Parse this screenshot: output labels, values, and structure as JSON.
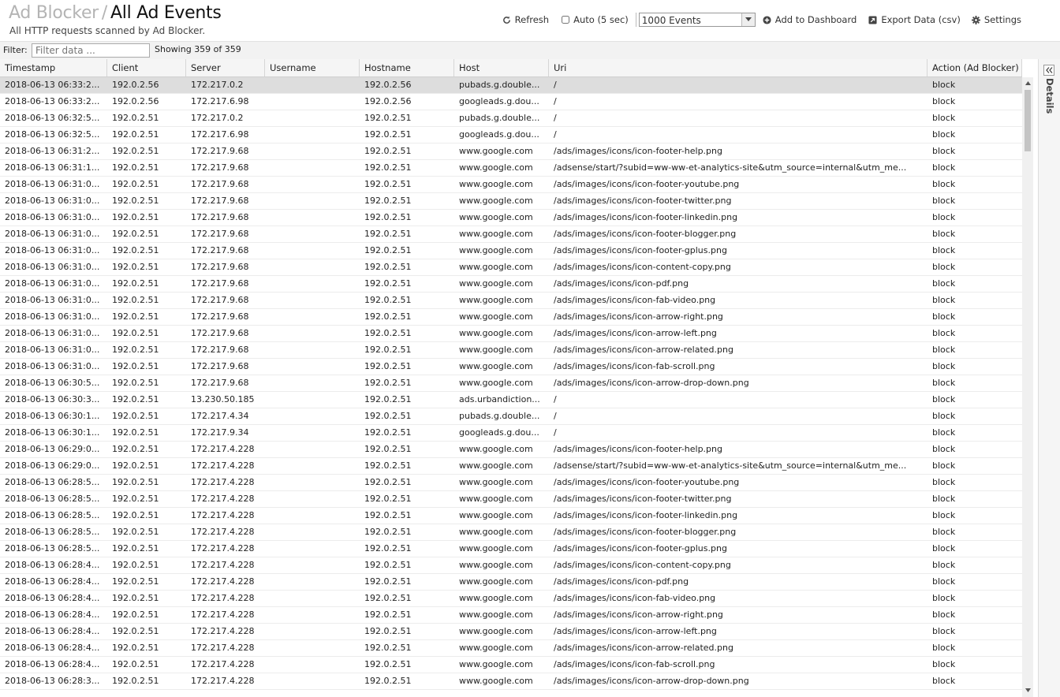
{
  "header": {
    "crumb": "Ad Blocker",
    "separator": "/",
    "title": "All Ad Events",
    "subtitle": "All HTTP requests scanned by Ad Blocker."
  },
  "toolbar": {
    "refresh_label": "Refresh",
    "auto_label": "Auto (5 sec)",
    "events_select": "1000 Events",
    "add_dashboard_label": "Add to Dashboard",
    "export_label": "Export Data (csv)",
    "settings_label": "Settings"
  },
  "filter": {
    "label": "Filter:",
    "placeholder": "Filter data ...",
    "showing": "Showing 359 of 359"
  },
  "columns": [
    "Timestamp",
    "Client",
    "Server",
    "Username",
    "Hostname",
    "Host",
    "Uri",
    "Action (Ad Blocker)"
  ],
  "rows": [
    [
      "2018-06-13 06:33:2...",
      "192.0.2.56",
      "172.217.0.2",
      "",
      "192.0.2.56",
      "pubads.g.double...",
      "/",
      "block"
    ],
    [
      "2018-06-13 06:33:2...",
      "192.0.2.56",
      "172.217.6.98",
      "",
      "192.0.2.56",
      "googleads.g.dou...",
      "/",
      "block"
    ],
    [
      "2018-06-13 06:32:5...",
      "192.0.2.51",
      "172.217.0.2",
      "",
      "192.0.2.51",
      "pubads.g.double...",
      "/",
      "block"
    ],
    [
      "2018-06-13 06:32:5...",
      "192.0.2.51",
      "172.217.6.98",
      "",
      "192.0.2.51",
      "googleads.g.dou...",
      "/",
      "block"
    ],
    [
      "2018-06-13 06:31:2...",
      "192.0.2.51",
      "172.217.9.68",
      "",
      "192.0.2.51",
      "www.google.com",
      "/ads/images/icons/icon-footer-help.png",
      "block"
    ],
    [
      "2018-06-13 06:31:1...",
      "192.0.2.51",
      "172.217.9.68",
      "",
      "192.0.2.51",
      "www.google.com",
      "/adsense/start/?subid=ww-ww-et-analytics-site&utm_source=internal&utm_me...",
      "block"
    ],
    [
      "2018-06-13 06:31:0...",
      "192.0.2.51",
      "172.217.9.68",
      "",
      "192.0.2.51",
      "www.google.com",
      "/ads/images/icons/icon-footer-youtube.png",
      "block"
    ],
    [
      "2018-06-13 06:31:0...",
      "192.0.2.51",
      "172.217.9.68",
      "",
      "192.0.2.51",
      "www.google.com",
      "/ads/images/icons/icon-footer-twitter.png",
      "block"
    ],
    [
      "2018-06-13 06:31:0...",
      "192.0.2.51",
      "172.217.9.68",
      "",
      "192.0.2.51",
      "www.google.com",
      "/ads/images/icons/icon-footer-linkedin.png",
      "block"
    ],
    [
      "2018-06-13 06:31:0...",
      "192.0.2.51",
      "172.217.9.68",
      "",
      "192.0.2.51",
      "www.google.com",
      "/ads/images/icons/icon-footer-blogger.png",
      "block"
    ],
    [
      "2018-06-13 06:31:0...",
      "192.0.2.51",
      "172.217.9.68",
      "",
      "192.0.2.51",
      "www.google.com",
      "/ads/images/icons/icon-footer-gplus.png",
      "block"
    ],
    [
      "2018-06-13 06:31:0...",
      "192.0.2.51",
      "172.217.9.68",
      "",
      "192.0.2.51",
      "www.google.com",
      "/ads/images/icons/icon-content-copy.png",
      "block"
    ],
    [
      "2018-06-13 06:31:0...",
      "192.0.2.51",
      "172.217.9.68",
      "",
      "192.0.2.51",
      "www.google.com",
      "/ads/images/icons/icon-pdf.png",
      "block"
    ],
    [
      "2018-06-13 06:31:0...",
      "192.0.2.51",
      "172.217.9.68",
      "",
      "192.0.2.51",
      "www.google.com",
      "/ads/images/icons/icon-fab-video.png",
      "block"
    ],
    [
      "2018-06-13 06:31:0...",
      "192.0.2.51",
      "172.217.9.68",
      "",
      "192.0.2.51",
      "www.google.com",
      "/ads/images/icons/icon-arrow-right.png",
      "block"
    ],
    [
      "2018-06-13 06:31:0...",
      "192.0.2.51",
      "172.217.9.68",
      "",
      "192.0.2.51",
      "www.google.com",
      "/ads/images/icons/icon-arrow-left.png",
      "block"
    ],
    [
      "2018-06-13 06:31:0...",
      "192.0.2.51",
      "172.217.9.68",
      "",
      "192.0.2.51",
      "www.google.com",
      "/ads/images/icons/icon-arrow-related.png",
      "block"
    ],
    [
      "2018-06-13 06:31:0...",
      "192.0.2.51",
      "172.217.9.68",
      "",
      "192.0.2.51",
      "www.google.com",
      "/ads/images/icons/icon-fab-scroll.png",
      "block"
    ],
    [
      "2018-06-13 06:30:5...",
      "192.0.2.51",
      "172.217.9.68",
      "",
      "192.0.2.51",
      "www.google.com",
      "/ads/images/icons/icon-arrow-drop-down.png",
      "block"
    ],
    [
      "2018-06-13 06:30:3...",
      "192.0.2.51",
      "13.230.50.185",
      "",
      "192.0.2.51",
      "ads.urbandiction...",
      "/",
      "block"
    ],
    [
      "2018-06-13 06:30:1...",
      "192.0.2.51",
      "172.217.4.34",
      "",
      "192.0.2.51",
      "pubads.g.double...",
      "/",
      "block"
    ],
    [
      "2018-06-13 06:30:1...",
      "192.0.2.51",
      "172.217.9.34",
      "",
      "192.0.2.51",
      "googleads.g.dou...",
      "/",
      "block"
    ],
    [
      "2018-06-13 06:29:0...",
      "192.0.2.51",
      "172.217.4.228",
      "",
      "192.0.2.51",
      "www.google.com",
      "/ads/images/icons/icon-footer-help.png",
      "block"
    ],
    [
      "2018-06-13 06:29:0...",
      "192.0.2.51",
      "172.217.4.228",
      "",
      "192.0.2.51",
      "www.google.com",
      "/adsense/start/?subid=ww-ww-et-analytics-site&utm_source=internal&utm_me...",
      "block"
    ],
    [
      "2018-06-13 06:28:5...",
      "192.0.2.51",
      "172.217.4.228",
      "",
      "192.0.2.51",
      "www.google.com",
      "/ads/images/icons/icon-footer-youtube.png",
      "block"
    ],
    [
      "2018-06-13 06:28:5...",
      "192.0.2.51",
      "172.217.4.228",
      "",
      "192.0.2.51",
      "www.google.com",
      "/ads/images/icons/icon-footer-twitter.png",
      "block"
    ],
    [
      "2018-06-13 06:28:5...",
      "192.0.2.51",
      "172.217.4.228",
      "",
      "192.0.2.51",
      "www.google.com",
      "/ads/images/icons/icon-footer-linkedin.png",
      "block"
    ],
    [
      "2018-06-13 06:28:5...",
      "192.0.2.51",
      "172.217.4.228",
      "",
      "192.0.2.51",
      "www.google.com",
      "/ads/images/icons/icon-footer-blogger.png",
      "block"
    ],
    [
      "2018-06-13 06:28:5...",
      "192.0.2.51",
      "172.217.4.228",
      "",
      "192.0.2.51",
      "www.google.com",
      "/ads/images/icons/icon-footer-gplus.png",
      "block"
    ],
    [
      "2018-06-13 06:28:4...",
      "192.0.2.51",
      "172.217.4.228",
      "",
      "192.0.2.51",
      "www.google.com",
      "/ads/images/icons/icon-content-copy.png",
      "block"
    ],
    [
      "2018-06-13 06:28:4...",
      "192.0.2.51",
      "172.217.4.228",
      "",
      "192.0.2.51",
      "www.google.com",
      "/ads/images/icons/icon-pdf.png",
      "block"
    ],
    [
      "2018-06-13 06:28:4...",
      "192.0.2.51",
      "172.217.4.228",
      "",
      "192.0.2.51",
      "www.google.com",
      "/ads/images/icons/icon-fab-video.png",
      "block"
    ],
    [
      "2018-06-13 06:28:4...",
      "192.0.2.51",
      "172.217.4.228",
      "",
      "192.0.2.51",
      "www.google.com",
      "/ads/images/icons/icon-arrow-right.png",
      "block"
    ],
    [
      "2018-06-13 06:28:4...",
      "192.0.2.51",
      "172.217.4.228",
      "",
      "192.0.2.51",
      "www.google.com",
      "/ads/images/icons/icon-arrow-left.png",
      "block"
    ],
    [
      "2018-06-13 06:28:4...",
      "192.0.2.51",
      "172.217.4.228",
      "",
      "192.0.2.51",
      "www.google.com",
      "/ads/images/icons/icon-arrow-related.png",
      "block"
    ],
    [
      "2018-06-13 06:28:4...",
      "192.0.2.51",
      "172.217.4.228",
      "",
      "192.0.2.51",
      "www.google.com",
      "/ads/images/icons/icon-fab-scroll.png",
      "block"
    ],
    [
      "2018-06-13 06:28:3...",
      "192.0.2.51",
      "172.217.4.228",
      "",
      "192.0.2.51",
      "www.google.com",
      "/ads/images/icons/icon-arrow-drop-down.png",
      "block"
    ]
  ],
  "details_label": "Details",
  "icons": {
    "refresh": "refresh-icon",
    "add_dashboard": "plus-circle-icon",
    "export": "export-icon",
    "settings": "gear-icon",
    "select_arrow": "chevron-down-icon",
    "details_toggle": "double-chevron-left-icon"
  }
}
